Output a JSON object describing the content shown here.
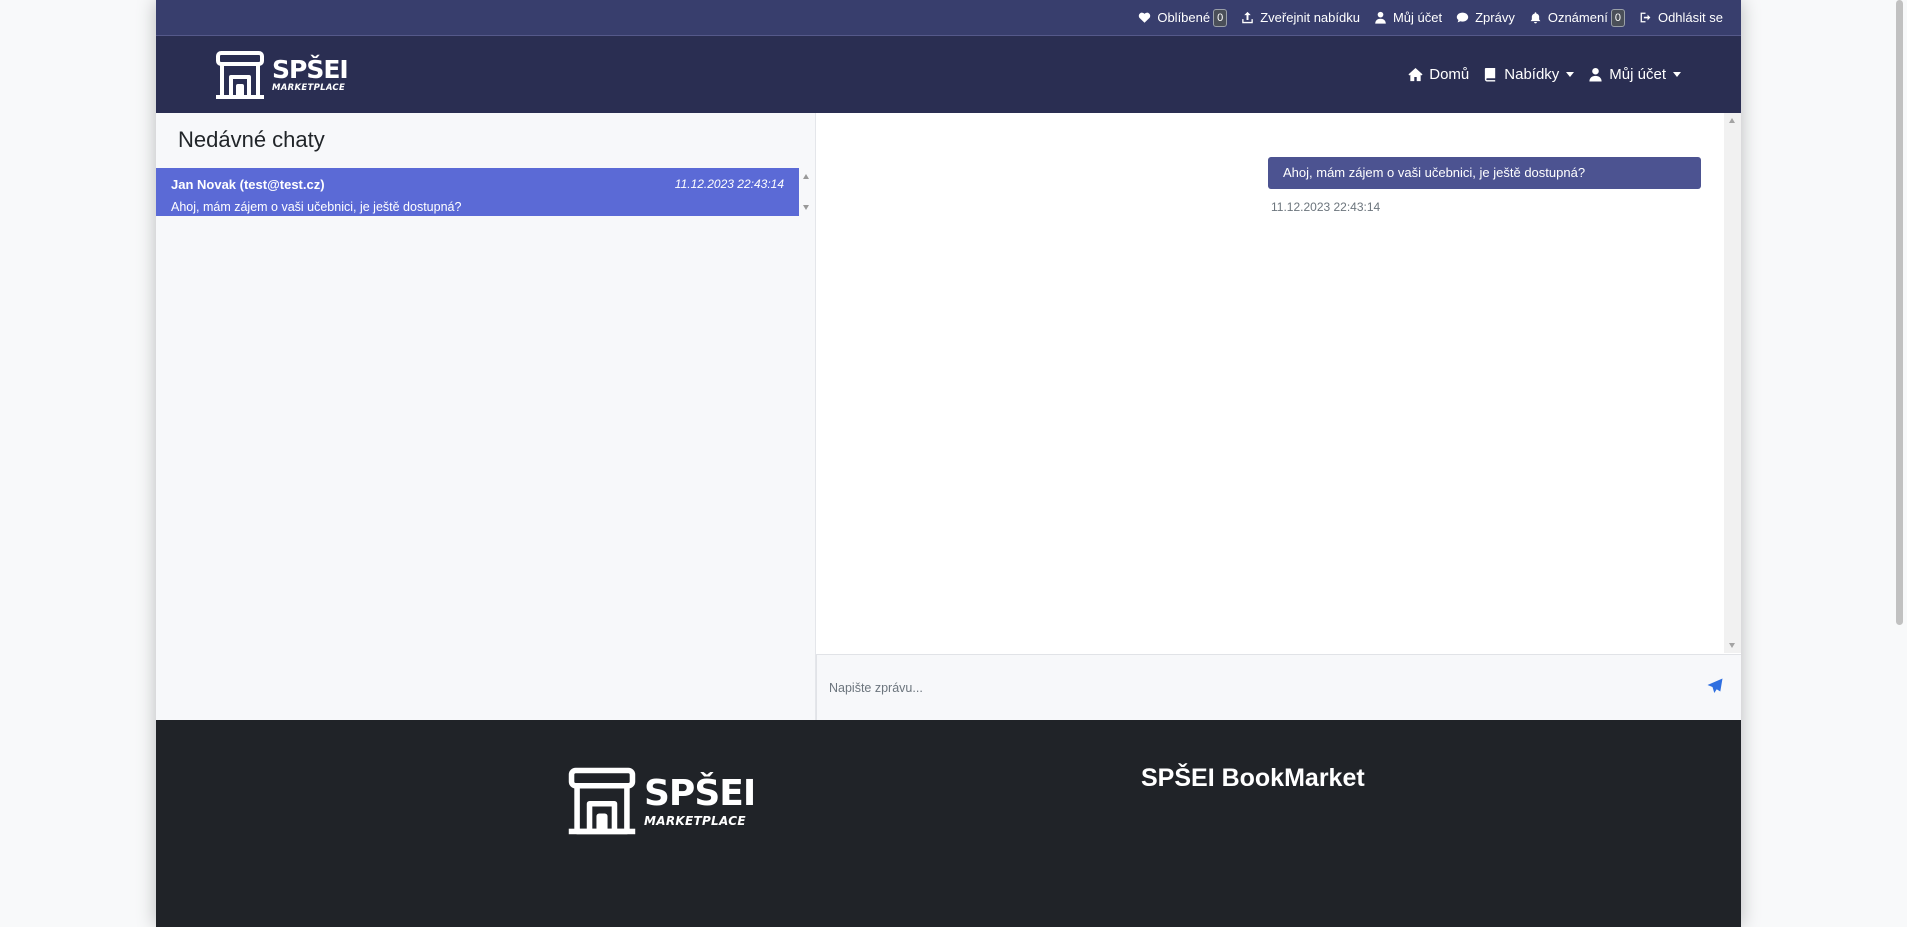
{
  "topbar": {
    "favorites_label": "Oblíbené",
    "favorites_count": "0",
    "publish_label": "Zveřejnit nabídku",
    "account_label": "Můj účet",
    "messages_label": "Zprávy",
    "notifications_label": "Oznámení",
    "notifications_count": "0",
    "logout_label": "Odhlásit se"
  },
  "brand": {
    "name": "SPŠEI",
    "tagline": "MARKETPLACE"
  },
  "nav": {
    "home_label": "Domů",
    "offers_label": "Nabídky",
    "account_label": "Můj účet"
  },
  "chats": {
    "title": "Nedávné chaty",
    "items": [
      {
        "name": "Jan Novak (test@test.cz)",
        "time": "11.12.2023 22:43:14",
        "preview": "Ahoj, mám zájem o vaši učebnici, je ještě dostupná?"
      }
    ]
  },
  "conversation": {
    "messages": [
      {
        "text": "Ahoj, mám zájem o vaši učebnici, je ještě dostupná?",
        "time": "11.12.2023 22:43:14"
      }
    ],
    "input_placeholder": "Napište zprávu..."
  },
  "footer": {
    "title": "SPŠEI BookMarket"
  },
  "colors": {
    "topbar": "#383e6d",
    "navbar": "#2a2e52",
    "active_chat": "#5b6ad6",
    "bubble": "#4c5391",
    "footer": "#202328",
    "send_icon": "#2f6fe0"
  },
  "icons": [
    "heart-icon",
    "upload-icon",
    "user-icon",
    "chat-icon",
    "bell-icon",
    "logout-icon",
    "home-icon",
    "book-icon",
    "send-icon"
  ]
}
